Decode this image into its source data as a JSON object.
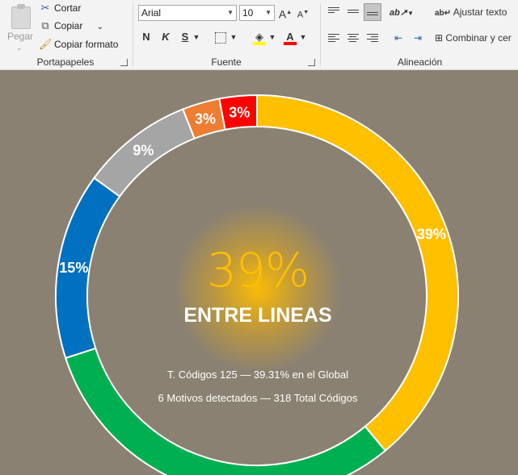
{
  "ribbon": {
    "clipboard": {
      "paste_label": "Pegar",
      "cut_label": "Cortar",
      "copy_label": "Copiar",
      "format_painter_label": "Copiar formato",
      "group_label": "Portapapeles"
    },
    "font": {
      "font_name": "Arial",
      "font_size": "10",
      "bold_label": "N",
      "italic_label": "K",
      "underline_label": "S",
      "grow_label": "A",
      "shrink_label": "A",
      "font_color_label": "A",
      "group_label": "Fuente"
    },
    "alignment": {
      "wrap_text_label": "Ajustar texto",
      "merge_label": "Combinar y cer",
      "group_label": "Alineación"
    }
  },
  "chart_data": {
    "type": "donut",
    "slices": [
      {
        "label": "39%",
        "value": 39,
        "color": "#ffc000"
      },
      {
        "label": "",
        "value": 31,
        "color": "#00b050"
      },
      {
        "label": "15%",
        "value": 15,
        "color": "#0070c0"
      },
      {
        "label": "9%",
        "value": 9,
        "color": "#a5a5a5"
      },
      {
        "label": "3%",
        "value": 3,
        "color": "#ed7d31"
      },
      {
        "label": "3%",
        "value": 3,
        "color": "#ff0000"
      }
    ],
    "center": {
      "percent": "39%",
      "title": "ENTRE LINEAS",
      "line1": "T. Códigos 125 — 39.31% en el Global",
      "line2": "6 Motivos detectados — 318 Total Códigos"
    }
  },
  "colors": {
    "background": "#8a8172",
    "accent": "#ffc000",
    "ribbon": "#f3f3f3"
  }
}
